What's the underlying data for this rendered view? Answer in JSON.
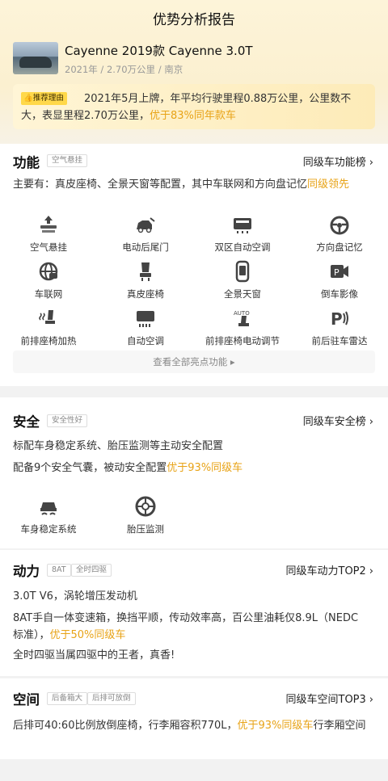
{
  "header": {
    "title": "优势分析报告"
  },
  "car": {
    "name": "Cayenne 2019款 Cayenne 3.0T",
    "meta": "2021年 / 2.70万公里 / 南京"
  },
  "reason": {
    "tag": "推荐理由",
    "text_plain": "2021年5月上牌，年平均行驶里程0.88万公里，公里数不大，表显里程2.70万公里，",
    "text_highlight": "优于83%同年款车"
  },
  "function": {
    "title": "功能",
    "chip": "空气悬挂",
    "rank": "同级车功能榜",
    "desc_plain": "主要有：真皮座椅、全景天窗等配置，其中车联网和方向盘记忆",
    "desc_highlight": "同级领先",
    "items": [
      {
        "label": "空气悬挂",
        "icon": "air-suspension-icon"
      },
      {
        "label": "电动后尾门",
        "icon": "power-tailgate-icon"
      },
      {
        "label": "双区自动空调",
        "icon": "dual-zone-ac-icon"
      },
      {
        "label": "方向盘记忆",
        "icon": "steering-memory-icon"
      },
      {
        "label": "车联网",
        "icon": "connected-car-icon"
      },
      {
        "label": "真皮座椅",
        "icon": "leather-seat-icon"
      },
      {
        "label": "全景天窗",
        "icon": "panoramic-sunroof-icon"
      },
      {
        "label": "倒车影像",
        "icon": "reverse-camera-icon"
      },
      {
        "label": "前排座椅加热",
        "icon": "seat-heating-icon"
      },
      {
        "label": "自动空调",
        "icon": "auto-ac-icon"
      },
      {
        "label": "前排座椅电动调节",
        "icon": "power-seat-icon"
      },
      {
        "label": "前后驻车雷达",
        "icon": "parking-radar-icon"
      }
    ],
    "more": "查看全部亮点功能 ▸"
  },
  "safety": {
    "title": "安全",
    "chip": "安全性好",
    "rank": "同级车安全榜",
    "line1": "标配车身稳定系统、胎压监测等主动安全配置",
    "line2_plain": "配备9个安全气囊，被动安全配置",
    "line2_highlight": "优于93%同级车",
    "items": [
      {
        "label": "车身稳定系统",
        "icon": "stability-control-icon"
      },
      {
        "label": "胎压监测",
        "icon": "tire-pressure-icon"
      }
    ]
  },
  "power": {
    "title": "动力",
    "chips": [
      "8AT",
      "全时四驱"
    ],
    "rank": "同级车动力TOP2",
    "line1": "3.0T V6，涡轮增压发动机",
    "line2_plain": "8AT手自一体变速箱，换挡平顺，传动效率高，百公里油耗仅8.9L（NEDC标准），",
    "line2_highlight": "优于50%同级车",
    "line3": "全时四驱当属四驱中的王者，真香!"
  },
  "space": {
    "title": "空间",
    "chips": [
      "后备箱大",
      "后排可放倒"
    ],
    "rank": "同级车空间TOP3",
    "line_plain": "后排可40:60比例放倒座椅，行李厢容积770L，",
    "line_highlight": "优于93%同级车",
    "line_tail": "行李厢空间"
  },
  "colors": {
    "accent": "#e8a317",
    "tag_bg": "#ffd84a"
  }
}
